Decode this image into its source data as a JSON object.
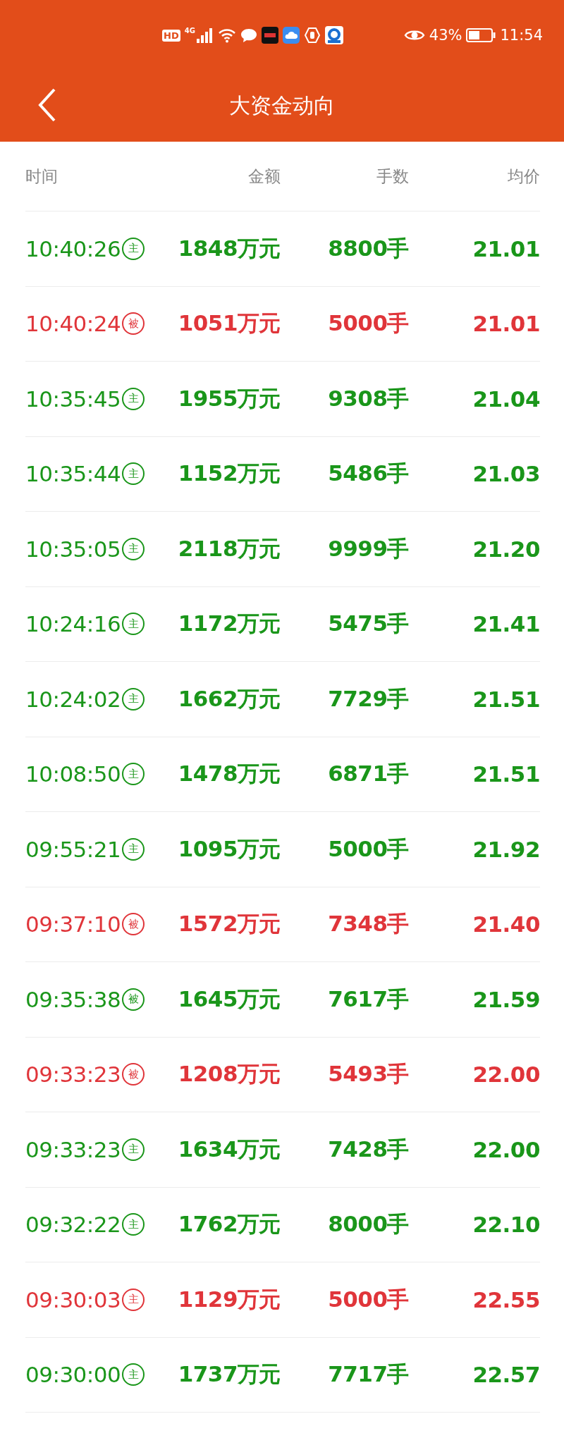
{
  "status_bar": {
    "hd": "HD",
    "network": "4G",
    "battery": "43%",
    "time": "11:54"
  },
  "header": {
    "title": "大资金动向"
  },
  "table": {
    "columns": [
      "时间",
      "金额",
      "手数",
      "均价"
    ],
    "rows": [
      {
        "time": "10:40:26",
        "badge": "主",
        "amount": "1848万元",
        "lots": "8800手",
        "price": "21.01",
        "color": "#1a961a"
      },
      {
        "time": "10:40:24",
        "badge": "被",
        "amount": "1051万元",
        "lots": "5000手",
        "price": "21.01",
        "color": "#e0353a"
      },
      {
        "time": "10:35:45",
        "badge": "主",
        "amount": "1955万元",
        "lots": "9308手",
        "price": "21.04",
        "color": "#1a961a"
      },
      {
        "time": "10:35:44",
        "badge": "主",
        "amount": "1152万元",
        "lots": "5486手",
        "price": "21.03",
        "color": "#1a961a"
      },
      {
        "time": "10:35:05",
        "badge": "主",
        "amount": "2118万元",
        "lots": "9999手",
        "price": "21.20",
        "color": "#1a961a"
      },
      {
        "time": "10:24:16",
        "badge": "主",
        "amount": "1172万元",
        "lots": "5475手",
        "price": "21.41",
        "color": "#1a961a"
      },
      {
        "time": "10:24:02",
        "badge": "主",
        "amount": "1662万元",
        "lots": "7729手",
        "price": "21.51",
        "color": "#1a961a"
      },
      {
        "time": "10:08:50",
        "badge": "主",
        "amount": "1478万元",
        "lots": "6871手",
        "price": "21.51",
        "color": "#1a961a"
      },
      {
        "time": "09:55:21",
        "badge": "主",
        "amount": "1095万元",
        "lots": "5000手",
        "price": "21.92",
        "color": "#1a961a"
      },
      {
        "time": "09:37:10",
        "badge": "被",
        "amount": "1572万元",
        "lots": "7348手",
        "price": "21.40",
        "color": "#e0353a"
      },
      {
        "time": "09:35:38",
        "badge": "被",
        "amount": "1645万元",
        "lots": "7617手",
        "price": "21.59",
        "color": "#1a961a"
      },
      {
        "time": "09:33:23",
        "badge": "被",
        "amount": "1208万元",
        "lots": "5493手",
        "price": "22.00",
        "color": "#e0353a"
      },
      {
        "time": "09:33:23",
        "badge": "主",
        "amount": "1634万元",
        "lots": "7428手",
        "price": "22.00",
        "color": "#1a961a"
      },
      {
        "time": "09:32:22",
        "badge": "主",
        "amount": "1762万元",
        "lots": "8000手",
        "price": "22.10",
        "color": "#1a961a"
      },
      {
        "time": "09:30:03",
        "badge": "主",
        "amount": "1129万元",
        "lots": "5000手",
        "price": "22.55",
        "color": "#e0353a"
      },
      {
        "time": "09:30:00",
        "badge": "主",
        "amount": "1737万元",
        "lots": "7717手",
        "price": "22.57",
        "color": "#1a961a"
      }
    ]
  }
}
